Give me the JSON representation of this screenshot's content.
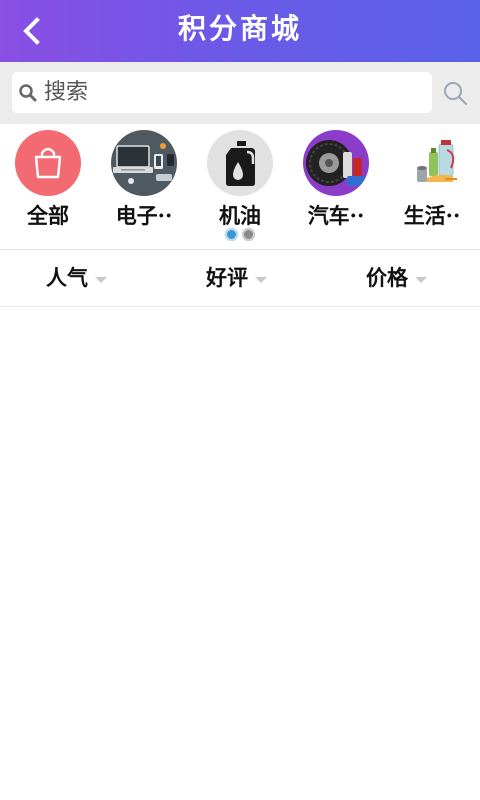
{
  "header": {
    "back_label": "<",
    "title": "积分商城"
  },
  "search": {
    "placeholder": "搜索"
  },
  "categories": [
    {
      "label": "全部",
      "icon": "shopping-bag-icon"
    },
    {
      "label": "电子··",
      "icon": "electronics-icon"
    },
    {
      "label": "机油",
      "icon": "engine-oil-icon"
    },
    {
      "label": "汽车··",
      "icon": "car-tire-icon"
    },
    {
      "label": "生活··",
      "icon": "daily-goods-icon"
    }
  ],
  "pager": {
    "total": 2,
    "active": 0
  },
  "sort": [
    {
      "label": "人气"
    },
    {
      "label": "好评"
    },
    {
      "label": "价格"
    }
  ],
  "colors": {
    "header_start": "#8a4fe3",
    "header_end": "#5a62ea",
    "all_icon_bg": "#f26b73",
    "pager_active": "#3a97d6",
    "pager_inactive": "#8a8a8a"
  }
}
